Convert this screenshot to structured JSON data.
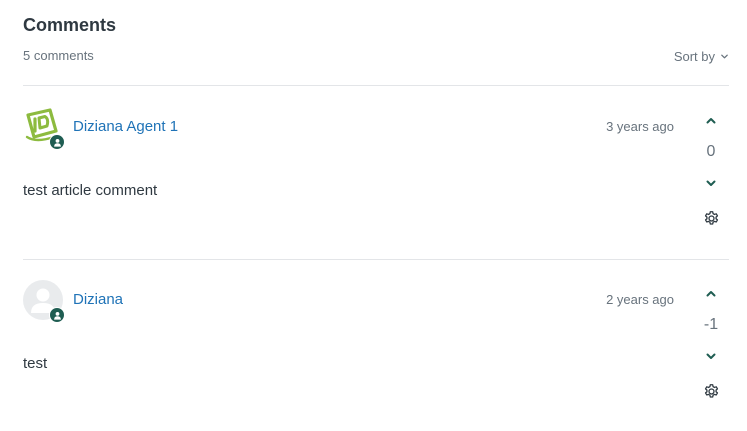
{
  "header": {
    "title": "Comments",
    "count_label": "5 comments",
    "sort_label": "Sort by"
  },
  "colors": {
    "link": "#1f73b7",
    "vote_icon": "#1f5d52",
    "badge": "#1f5d52"
  },
  "comments": [
    {
      "author": "Diziana Agent 1",
      "avatar": "diziana-logo-icon",
      "agent_badge": "agent-badge-icon",
      "timestamp": "3 years ago",
      "body": "test article comment",
      "votes": "0"
    },
    {
      "author": "Diziana",
      "avatar": "default-user-icon",
      "agent_badge": "agent-badge-icon",
      "timestamp": "2 years ago",
      "body": "test",
      "votes": "-1"
    }
  ]
}
